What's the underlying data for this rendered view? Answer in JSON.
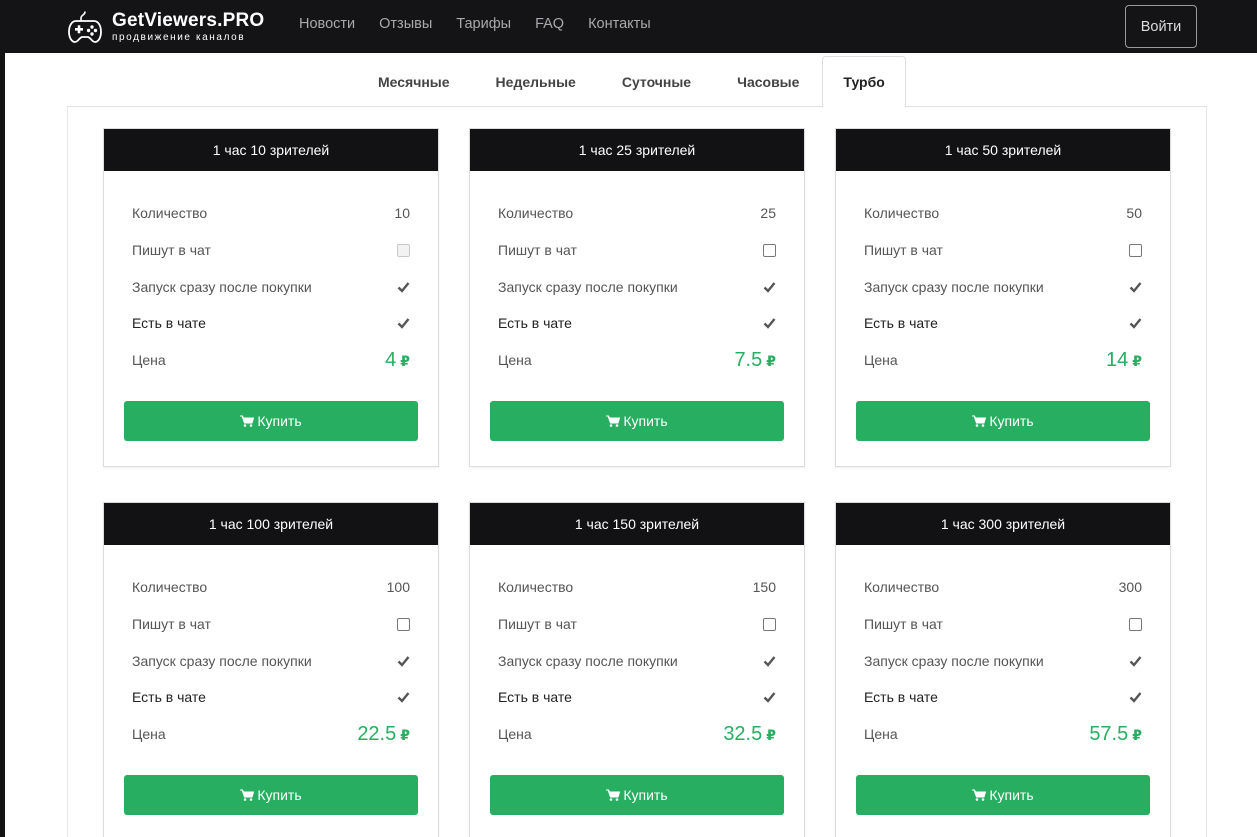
{
  "header": {
    "brand_title": "GetViewers.PRO",
    "brand_subtitle": "продвижение каналов",
    "nav": [
      "Новости",
      "Отзывы",
      "Тарифы",
      "FAQ",
      "Контакты"
    ],
    "login_label": "Войти"
  },
  "tabs": [
    "Месячные",
    "Недельные",
    "Суточные",
    "Часовые",
    "Турбо"
  ],
  "active_tab": "Турбо",
  "row_labels": {
    "quantity": "Количество",
    "chat": "Пишут в чат",
    "instant": "Запуск сразу после покупки",
    "in_chat": "Есть в чате",
    "price": "Цена"
  },
  "currency": "₽",
  "buy_label": "Купить",
  "colors": {
    "accent": "#27ae60",
    "header_bg": "#141417"
  },
  "cards": [
    {
      "title": "1 час 10 зрителей",
      "quantity": "10",
      "price": "4",
      "chat_disabled": true
    },
    {
      "title": "1 час 25 зрителей",
      "quantity": "25",
      "price": "7.5",
      "chat_disabled": false
    },
    {
      "title": "1 час 50 зрителей",
      "quantity": "50",
      "price": "14",
      "chat_disabled": false
    },
    {
      "title": "1 час 100 зрителей",
      "quantity": "100",
      "price": "22.5",
      "chat_disabled": false
    },
    {
      "title": "1 час 150 зрителей",
      "quantity": "150",
      "price": "32.5",
      "chat_disabled": false
    },
    {
      "title": "1 час 300 зрителей",
      "quantity": "300",
      "price": "57.5",
      "chat_disabled": false
    }
  ]
}
